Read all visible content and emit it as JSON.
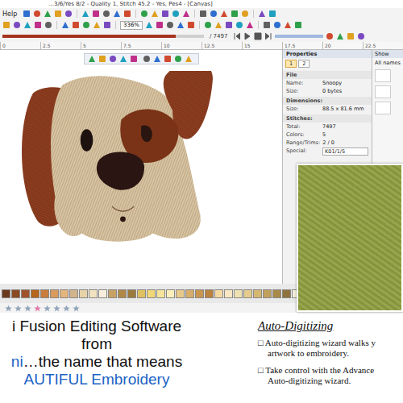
{
  "window": {
    "title": "…3/6/Yes 8/2 - Quality 1, Stitch 45.2 - Yes, Pes4 - [Canvas]"
  },
  "menu": {
    "help": "Help"
  },
  "toolbar": {
    "zoom": "336%",
    "stitch_total": "/ 7497",
    "stitch_level": 0.86
  },
  "ruler": [
    "0",
    "2.5",
    "5",
    "7.5",
    "10",
    "12.5",
    "15",
    "17.5",
    "20",
    "22.5"
  ],
  "properties": {
    "title": "Properties",
    "tabs": [
      {
        "label": "1",
        "selected": true
      },
      {
        "label": "2",
        "selected": false
      }
    ],
    "rows": [
      {
        "kind": "section",
        "label": "File"
      },
      {
        "kind": "field",
        "label": "Name:",
        "value": "Snoopy"
      },
      {
        "kind": "field",
        "label": "Size:",
        "value": "0 bytes"
      },
      {
        "kind": "section",
        "label": "Dimensions:"
      },
      {
        "kind": "field",
        "label": "Size:",
        "value": "88.5 x 81.6 mm"
      },
      {
        "kind": "section",
        "label": "Stitches:"
      },
      {
        "kind": "field",
        "label": "Total:",
        "value": "7497"
      },
      {
        "kind": "field",
        "label": "Colors:",
        "value": "5"
      },
      {
        "kind": "field",
        "label": "Range/Trims:",
        "value": "2 / 0"
      },
      {
        "kind": "dropdown",
        "label": "Special:",
        "value": "K01/1/5"
      }
    ]
  },
  "side_panel": {
    "title": "Show",
    "filter": "All names"
  },
  "palette": [
    {
      "color": "#6b3a1e"
    },
    {
      "color": "#8b4a22"
    },
    {
      "color": "#a0522d"
    },
    {
      "color": "#b5651d"
    },
    {
      "color": "#c97c3c"
    },
    {
      "color": "#d99a5b"
    },
    {
      "color": "#e5b57e"
    },
    {
      "color": "#d2b48c"
    },
    {
      "color": "#e8d3a8"
    },
    {
      "color": "#f1e2c0"
    },
    {
      "color": "#f7eedb"
    },
    {
      "color": "#c8a165"
    },
    {
      "color": "#b08848"
    },
    {
      "color": "#9c7a3c"
    },
    {
      "color": "#e0c060"
    },
    {
      "color": "#f0d878"
    },
    {
      "color": "#f5e49a"
    },
    {
      "color": "#fbeebb"
    },
    {
      "color": "#e8c98a"
    },
    {
      "color": "#d6ad6b"
    },
    {
      "color": "#c9954f"
    },
    {
      "color": "#bb8240"
    },
    {
      "color": "#f4d9a0"
    },
    {
      "color": "#f9e7c4"
    },
    {
      "color": "#efe0b0"
    },
    {
      "color": "#e6cc8c"
    },
    {
      "color": "#d4b870"
    },
    {
      "color": "#c0a05a"
    },
    {
      "color": "#a88a4a"
    },
    {
      "color": "#8f733c"
    },
    {
      "color": "#f5f0dc"
    },
    {
      "color": "#e9e0c4"
    },
    {
      "color": "#ded2ae"
    },
    {
      "color": "#d0c298"
    },
    {
      "color": "#c2b282"
    },
    {
      "color": "#b4a26e"
    },
    {
      "color": "#a8985e"
    },
    {
      "color": "#9a8a50"
    }
  ],
  "promo": {
    "line1": "i Fusion Editing Software",
    "line2": "from",
    "line3_blue": "ni",
    "line3_rest": "…the name that means",
    "line4": "AUTIFUL Embroidery"
  },
  "feature": {
    "heading": "Auto-Digitizing",
    "bullets": [
      [
        "□ Auto-digitizing wizard walks y",
        "artwork to embroidery."
      ],
      [
        "□ Take control with the Advance",
        "Auto-digitizing wizard."
      ]
    ]
  }
}
